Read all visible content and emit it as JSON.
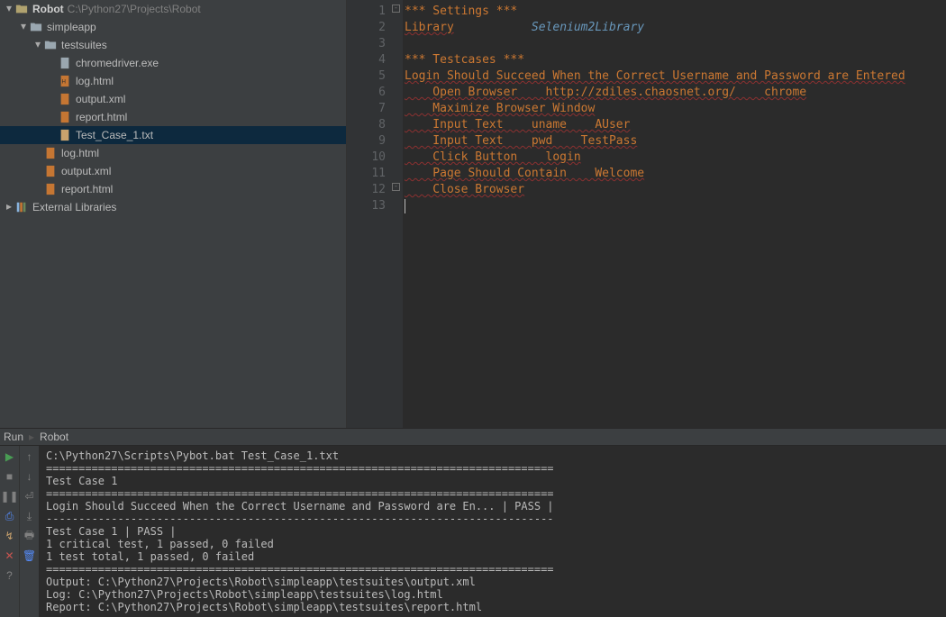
{
  "project": {
    "name": "Robot",
    "path": "C:\\Python27\\Projects\\Robot"
  },
  "tree": [
    {
      "k": "root",
      "label": "Robot",
      "path": "C:\\Python27\\Projects\\Robot"
    },
    {
      "k": "simpleapp",
      "label": "simpleapp"
    },
    {
      "k": "testsuites",
      "label": "testsuites"
    },
    {
      "k": "chromedriver",
      "label": "chromedriver.exe"
    },
    {
      "k": "ts_log",
      "label": "log.html"
    },
    {
      "k": "ts_output",
      "label": "output.xml"
    },
    {
      "k": "ts_report",
      "label": "report.html"
    },
    {
      "k": "tc1",
      "label": "Test_Case_1.txt"
    },
    {
      "k": "sa_log",
      "label": "log.html"
    },
    {
      "k": "sa_output",
      "label": "output.xml"
    },
    {
      "k": "sa_report",
      "label": "report.html"
    },
    {
      "k": "extlib",
      "label": "External Libraries"
    }
  ],
  "code": {
    "l1": "*** Settings ***",
    "l2a": "Library",
    "l2b": "Selenium2Library",
    "l4": "*** Testcases ***",
    "l5": "Login Should Succeed When the Correct Username and Password are Entered",
    "l6": "    Open Browser    http://zdiles.chaosnet.org/    chrome",
    "l7": "    Maximize Browser Window",
    "l8": "    Input Text    uname    AUser",
    "l9": "    Input Text    pwd    TestPass",
    "l10": "    Click Button    login",
    "l11": "    Page Should Contain    Welcome",
    "l12": "    Close Browser"
  },
  "linenums": [
    "1",
    "2",
    "3",
    "4",
    "5",
    "6",
    "7",
    "8",
    "9",
    "10",
    "11",
    "12",
    "13"
  ],
  "run": {
    "header_left": "Run",
    "header_right": "Robot",
    "cmd": "C:\\Python27\\Scripts\\Pybot.bat Test_Case_1.txt",
    "sep": "==============================================================================",
    "tc_line": "Test Case 1",
    "login_line": "Login Should Succeed When the Correct Username and Password are En... | PASS |",
    "dash": "------------------------------------------------------------------------------",
    "tc_pass": "Test Case 1                                                           | PASS |",
    "crit": "1 critical test, 1 passed, 0 failed",
    "total": "1 test total, 1 passed, 0 failed",
    "out_l": "Output:  ",
    "out_v": "C:\\Python27\\Projects\\Robot\\simpleapp\\testsuites\\output.xml",
    "log_l": "Log:     ",
    "log_v": "C:\\Python27\\Projects\\Robot\\simpleapp\\testsuites\\log.html",
    "rep_l": "Report:  ",
    "rep_v": "C:\\Python27\\Projects\\Robot\\simpleapp\\testsuites\\report.html"
  }
}
